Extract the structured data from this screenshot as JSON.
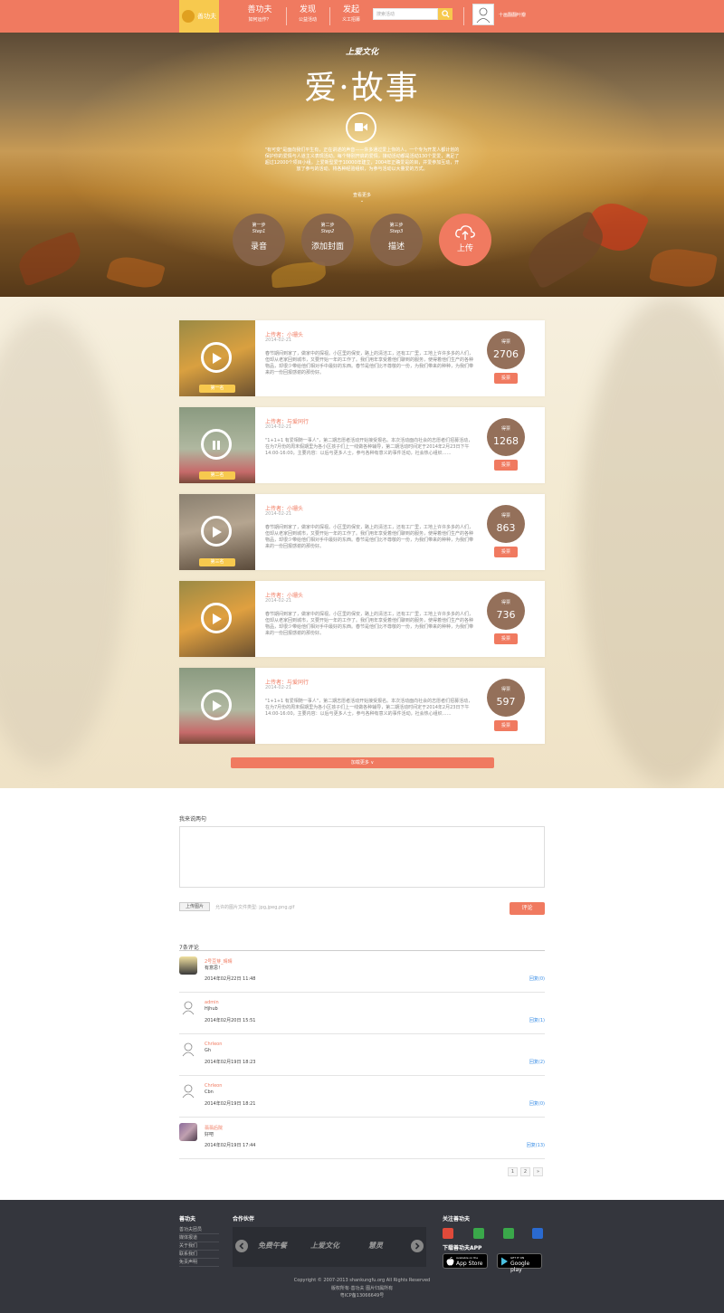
{
  "header": {
    "logo_text": "善功夫",
    "nav": [
      {
        "title": "善功夫",
        "sub": "如何运作？"
      },
      {
        "title": "发现",
        "sub": "公益活动"
      },
      {
        "title": "发起",
        "sub": "义工招募"
      }
    ],
    "search_placeholder": "搜索活动",
    "user_name": "十画翻翻叶瓣"
  },
  "hero": {
    "brand": "上爱文化",
    "title": "爱·故事",
    "description": "\"有可变\"是面向我们平生有，正在讲述的声音——许多通过爱上你的人，一个专为开发人都计划的保护你的爱情与人道主义表现活动。每个特别开启的爱情，接动活动都是活动130个爱爱，满足了超过12000个项目小组。上爱新型爱于10000年建立，2004年正确爱是的目，并爱参加互动，开放了参与的活动，将各种经验组织，为参与活动以大量爱的方式。",
    "more": "查看更多",
    "steps": [
      {
        "step": "第一步",
        "step_en": "Step1",
        "label": "录音"
      },
      {
        "step": "第二步",
        "step_en": "Step2",
        "label": "添加封面"
      },
      {
        "step": "第三步",
        "step_en": "Step3",
        "label": "描述"
      }
    ],
    "upload_label": "上传"
  },
  "stories": {
    "items": [
      {
        "uploader": "上传者：小珊头",
        "date": "2014-02-21",
        "text": "春节期间到家了，做家中的探视。小区里的保安，路上的清洁工，还有工厂里，工地上许许多多的人们，但却从老家回到城市，又要开始一年的工作了。我们用年享受着他们聊到的服务，使得着他们生产的各种物品，却很少带给他们相对手中最好的东西。春节是他们比不尊敬的一份，为我们带来的种种，为我们带来的一份回报感谢的那份好。",
        "votes_label": "得票",
        "votes": "2706",
        "vote_btn": "投票",
        "tag": "第一名",
        "state": "play"
      },
      {
        "uploader": "上传者：与爱同行",
        "date": "2014-02-21",
        "text": "\"1+1+1 有爱相随一事人\"，第二期志愿者活动开始接受报名。本次活动面向社会的志愿者们招募活动，在为7月份的周末假期里为各小区孩子们上一线做各种辅导，第二期活动时间定于2014年2月23日下午14:00-16:00，主要内容：以后与更多人士，参与各种有意义的事件活动，社会热心组织……",
        "votes_label": "得票",
        "votes": "1268",
        "vote_btn": "投票",
        "tag": "第二名",
        "state": "pause"
      },
      {
        "uploader": "上传者：小珊头",
        "date": "2014-02-21",
        "text": "春节期间到家了，做家中的探视。小区里的保安，路上的清洁工，还有工厂里，工地上许许多多的人们，但却从老家回到城市，又要开始一年的工作了。我们用年享受着他们聊到的服务，使得着他们生产的各种物品，却很少带给他们相对手中最好的东西。春节是他们比不尊敬的一份，为我们带来的种种，为我们带来的一份回报感谢的那份好。",
        "votes_label": "得票",
        "votes": "863",
        "vote_btn": "投票",
        "tag": "第三名",
        "state": "play"
      },
      {
        "uploader": "上传者：小珊头",
        "date": "2014-02-21",
        "text": "春节期间到家了，做家中的探视。小区里的保安，路上的清洁工，还有工厂里，工地上许许多多的人们，但却从老家回到城市，又要开始一年的工作了。我们用年享受着他们聊到的服务，使得着他们生产的各种物品，却很少带给他们相对手中最好的东西。春节是他们比不尊敬的一份，为我们带来的种种，为我们带来的一份回报感谢的那份好。",
        "votes_label": "得票",
        "votes": "736",
        "vote_btn": "投票",
        "tag": "",
        "state": "play"
      },
      {
        "uploader": "上传者：与爱同行",
        "date": "2014-02-21",
        "text": "\"1+1+1 有爱相随一事人\"，第二期志愿者活动开始接受报名。本次活动面向社会的志愿者们招募活动，在为7月份的周末假期里为各小区孩子们上一线做各种辅导，第二期活动时间定于2014年2月23日下午14:00-16:00，主要内容：以后与更多人士，参与各种有意义的事件活动，社会热心组织……",
        "votes_label": "得票",
        "votes": "597",
        "vote_btn": "投票",
        "tag": "",
        "state": "play"
      }
    ],
    "load_more": "加载更多 ∨"
  },
  "comments": {
    "label": "我来说两句",
    "upload_btn": "上传图片",
    "upload_hint": "允许的图片文件类型: jpg,jpeg,png,gif",
    "submit": "评论",
    "count": "7条评论",
    "items": [
      {
        "name": "2号豆芽_晴晴",
        "content": "有意思！",
        "time": "2014年02月22日 11:48",
        "reply": "回复(0)"
      },
      {
        "name": "admin",
        "content": "Hjhub",
        "time": "2014年02月20日 15:51",
        "reply": "回复(1)"
      },
      {
        "name": "Chrleon",
        "content": "Gh",
        "time": "2014年02月19日 18:23",
        "reply": "回复(2)"
      },
      {
        "name": "Chrleon",
        "content": "Cbn",
        "time": "2014年02月19日 18:21",
        "reply": "回复(0)"
      },
      {
        "name": "翡翡后院",
        "content": "好吧",
        "time": "2014年02月19日 17:44",
        "reply": "回复(13)"
      }
    ],
    "pages": [
      "1",
      "2",
      "»"
    ]
  },
  "footer": {
    "col1_title": "善功夫",
    "col1_links": [
      "善功夫团员",
      "媒体报道",
      "关于我们",
      "联系我们",
      "免责声明"
    ],
    "partners_title": "合作伙伴",
    "partners": [
      "免费午餐",
      "上爱文化",
      "慧灵"
    ],
    "follow_title": "关注善功夫",
    "app_title": "下载善功夫APP",
    "appstore_small": "Available on the",
    "appstore": "App Store",
    "googleplay_small": "GET IT ON",
    "googleplay": "Google play",
    "copyright": "Copyright © 2007-2013 shankungfu.org All Rights Reserved",
    "line2": "版权所有·善功夫 图片归属所有",
    "icp": "粤ICP备13066649号"
  },
  "colors": {
    "accent": "#f07a60",
    "yellow": "#f7c94e",
    "vote_brown": "#94705a",
    "footer_bg": "#34363d"
  }
}
